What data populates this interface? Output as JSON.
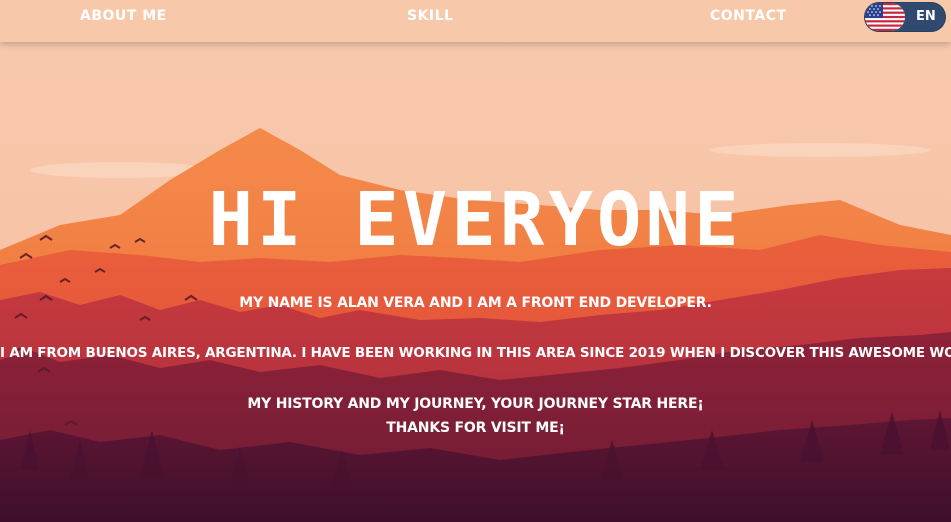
{
  "nav": {
    "about_label": "ABOUT ME",
    "skill_label": "SKILL",
    "contact_label": "CONTACT"
  },
  "language": {
    "label": "EN",
    "flag_icon": "us-flag-icon"
  },
  "hero": {
    "title": "HI EVERYONE",
    "line1": "MY NAME IS ALAN VERA AND I AM A FRONT END DEVELOPER.",
    "line2": "I AM FROM BUENOS AIRES, ARGENTINA. I HAVE BEEN WORKING IN THIS AREA SINCE 2019 WHEN I DISCOVER THIS AWESOME WORLD.",
    "line3": "MY HISTORY AND MY JOURNEY, YOUR JOURNEY STAR HERE¡",
    "line4": "THANKS FOR VISIT ME¡"
  },
  "colors": {
    "topbar": "#f8c8aa",
    "toggle": "#2f4a6e",
    "sky_top": "#f7c4a6",
    "mountain_orange": "#f07a3f",
    "forest_dark": "#5a1431"
  }
}
